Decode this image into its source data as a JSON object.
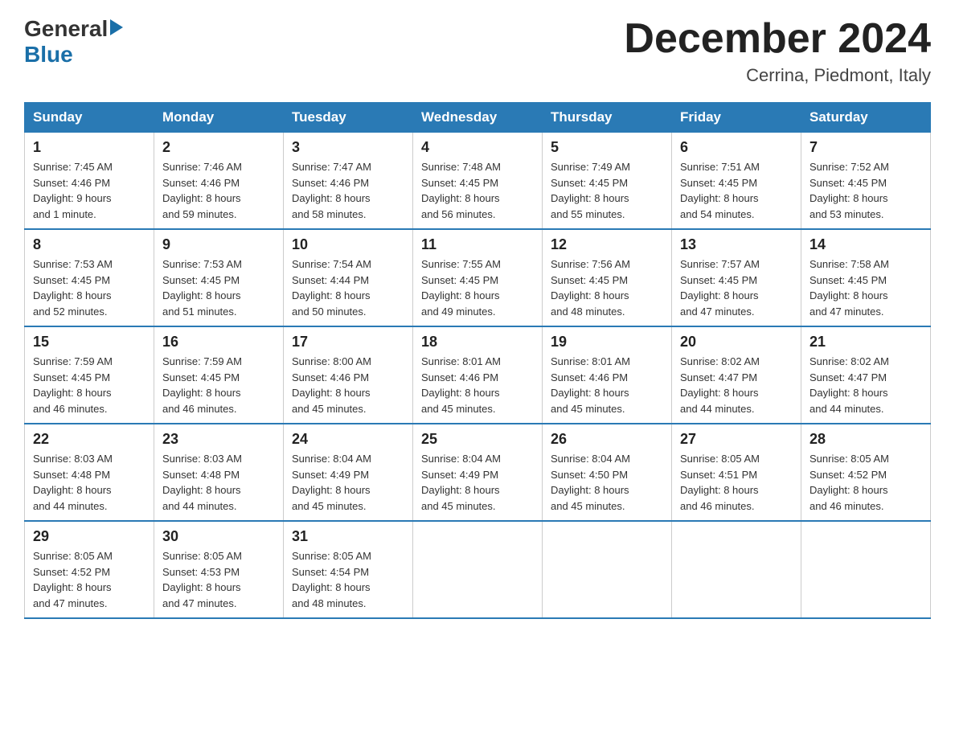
{
  "logo": {
    "general": "General",
    "arrow": "▶",
    "blue": "Blue"
  },
  "header": {
    "title": "December 2024",
    "subtitle": "Cerrina, Piedmont, Italy"
  },
  "days_of_week": [
    "Sunday",
    "Monday",
    "Tuesday",
    "Wednesday",
    "Thursday",
    "Friday",
    "Saturday"
  ],
  "weeks": [
    [
      {
        "day": "1",
        "sunrise": "7:45 AM",
        "sunset": "4:46 PM",
        "daylight": "9 hours and 1 minute."
      },
      {
        "day": "2",
        "sunrise": "7:46 AM",
        "sunset": "4:46 PM",
        "daylight": "8 hours and 59 minutes."
      },
      {
        "day": "3",
        "sunrise": "7:47 AM",
        "sunset": "4:46 PM",
        "daylight": "8 hours and 58 minutes."
      },
      {
        "day": "4",
        "sunrise": "7:48 AM",
        "sunset": "4:45 PM",
        "daylight": "8 hours and 56 minutes."
      },
      {
        "day": "5",
        "sunrise": "7:49 AM",
        "sunset": "4:45 PM",
        "daylight": "8 hours and 55 minutes."
      },
      {
        "day": "6",
        "sunrise": "7:51 AM",
        "sunset": "4:45 PM",
        "daylight": "8 hours and 54 minutes."
      },
      {
        "day": "7",
        "sunrise": "7:52 AM",
        "sunset": "4:45 PM",
        "daylight": "8 hours and 53 minutes."
      }
    ],
    [
      {
        "day": "8",
        "sunrise": "7:53 AM",
        "sunset": "4:45 PM",
        "daylight": "8 hours and 52 minutes."
      },
      {
        "day": "9",
        "sunrise": "7:53 AM",
        "sunset": "4:45 PM",
        "daylight": "8 hours and 51 minutes."
      },
      {
        "day": "10",
        "sunrise": "7:54 AM",
        "sunset": "4:44 PM",
        "daylight": "8 hours and 50 minutes."
      },
      {
        "day": "11",
        "sunrise": "7:55 AM",
        "sunset": "4:45 PM",
        "daylight": "8 hours and 49 minutes."
      },
      {
        "day": "12",
        "sunrise": "7:56 AM",
        "sunset": "4:45 PM",
        "daylight": "8 hours and 48 minutes."
      },
      {
        "day": "13",
        "sunrise": "7:57 AM",
        "sunset": "4:45 PM",
        "daylight": "8 hours and 47 minutes."
      },
      {
        "day": "14",
        "sunrise": "7:58 AM",
        "sunset": "4:45 PM",
        "daylight": "8 hours and 47 minutes."
      }
    ],
    [
      {
        "day": "15",
        "sunrise": "7:59 AM",
        "sunset": "4:45 PM",
        "daylight": "8 hours and 46 minutes."
      },
      {
        "day": "16",
        "sunrise": "7:59 AM",
        "sunset": "4:45 PM",
        "daylight": "8 hours and 46 minutes."
      },
      {
        "day": "17",
        "sunrise": "8:00 AM",
        "sunset": "4:46 PM",
        "daylight": "8 hours and 45 minutes."
      },
      {
        "day": "18",
        "sunrise": "8:01 AM",
        "sunset": "4:46 PM",
        "daylight": "8 hours and 45 minutes."
      },
      {
        "day": "19",
        "sunrise": "8:01 AM",
        "sunset": "4:46 PM",
        "daylight": "8 hours and 45 minutes."
      },
      {
        "day": "20",
        "sunrise": "8:02 AM",
        "sunset": "4:47 PM",
        "daylight": "8 hours and 44 minutes."
      },
      {
        "day": "21",
        "sunrise": "8:02 AM",
        "sunset": "4:47 PM",
        "daylight": "8 hours and 44 minutes."
      }
    ],
    [
      {
        "day": "22",
        "sunrise": "8:03 AM",
        "sunset": "4:48 PM",
        "daylight": "8 hours and 44 minutes."
      },
      {
        "day": "23",
        "sunrise": "8:03 AM",
        "sunset": "4:48 PM",
        "daylight": "8 hours and 44 minutes."
      },
      {
        "day": "24",
        "sunrise": "8:04 AM",
        "sunset": "4:49 PM",
        "daylight": "8 hours and 45 minutes."
      },
      {
        "day": "25",
        "sunrise": "8:04 AM",
        "sunset": "4:49 PM",
        "daylight": "8 hours and 45 minutes."
      },
      {
        "day": "26",
        "sunrise": "8:04 AM",
        "sunset": "4:50 PM",
        "daylight": "8 hours and 45 minutes."
      },
      {
        "day": "27",
        "sunrise": "8:05 AM",
        "sunset": "4:51 PM",
        "daylight": "8 hours and 46 minutes."
      },
      {
        "day": "28",
        "sunrise": "8:05 AM",
        "sunset": "4:52 PM",
        "daylight": "8 hours and 46 minutes."
      }
    ],
    [
      {
        "day": "29",
        "sunrise": "8:05 AM",
        "sunset": "4:52 PM",
        "daylight": "8 hours and 47 minutes."
      },
      {
        "day": "30",
        "sunrise": "8:05 AM",
        "sunset": "4:53 PM",
        "daylight": "8 hours and 47 minutes."
      },
      {
        "day": "31",
        "sunrise": "8:05 AM",
        "sunset": "4:54 PM",
        "daylight": "8 hours and 48 minutes."
      },
      null,
      null,
      null,
      null
    ]
  ],
  "labels": {
    "sunrise": "Sunrise:",
    "sunset": "Sunset:",
    "daylight": "Daylight:"
  }
}
